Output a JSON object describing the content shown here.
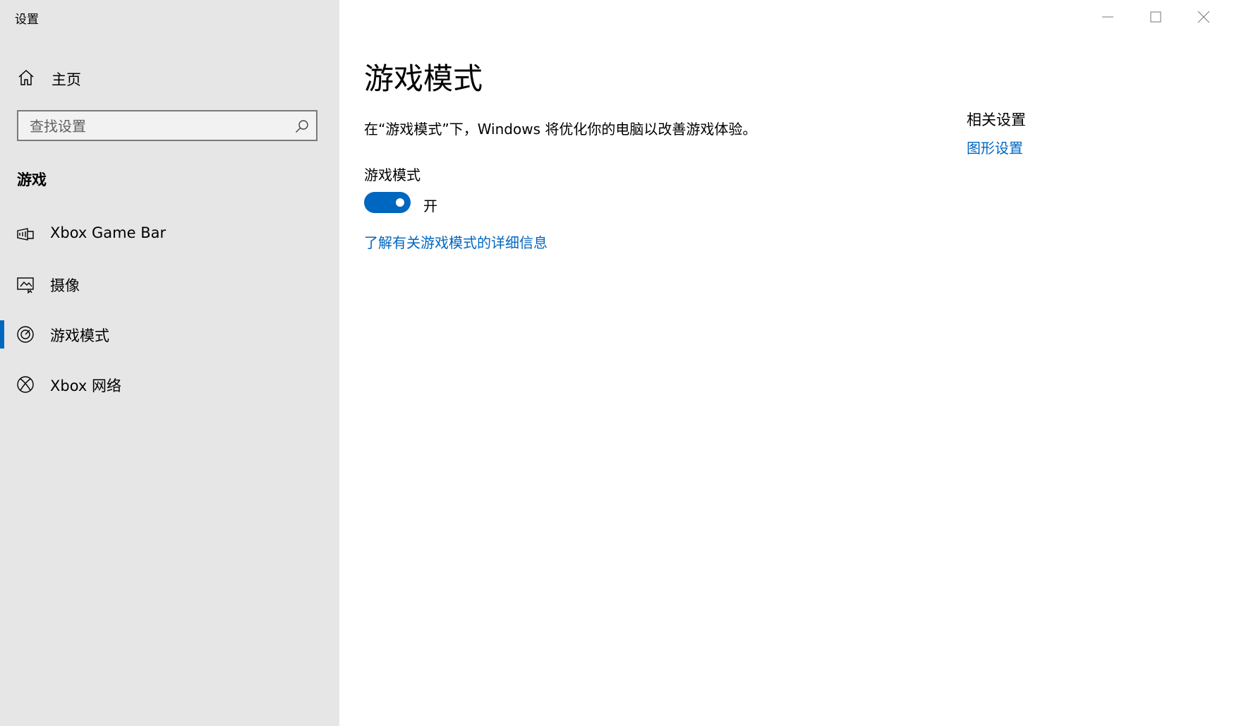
{
  "window": {
    "title": "设置",
    "controls": {
      "minimize": "minimize-icon",
      "maximize": "maximize-icon",
      "close": "close-icon"
    }
  },
  "sidebar": {
    "home_label": "主页",
    "home_icon": "home-icon",
    "search": {
      "placeholder": "查找设置",
      "value": "",
      "icon": "search-icon"
    },
    "section_title": "游戏",
    "items": [
      {
        "label": "Xbox Game Bar",
        "icon": "game-bar-icon",
        "selected": false
      },
      {
        "label": "摄像",
        "icon": "captures-icon",
        "selected": false
      },
      {
        "label": "游戏模式",
        "icon": "game-mode-icon",
        "selected": true
      },
      {
        "label": "Xbox 网络",
        "icon": "xbox-icon",
        "selected": false
      }
    ]
  },
  "main": {
    "title": "游戏模式",
    "description": "在“游戏模式”下，Windows 将优化你的电脑以改善游戏体验。",
    "setting_label": "游戏模式",
    "toggle": {
      "on": true,
      "state_label": "开"
    },
    "learn_more": "了解有关游戏模式的详细信息"
  },
  "related": {
    "title": "相关设置",
    "links": [
      "图形设置"
    ]
  },
  "colors": {
    "accent": "#0067c0",
    "sidebar_bg": "#e6e6e6",
    "content_bg": "#ffffff"
  }
}
